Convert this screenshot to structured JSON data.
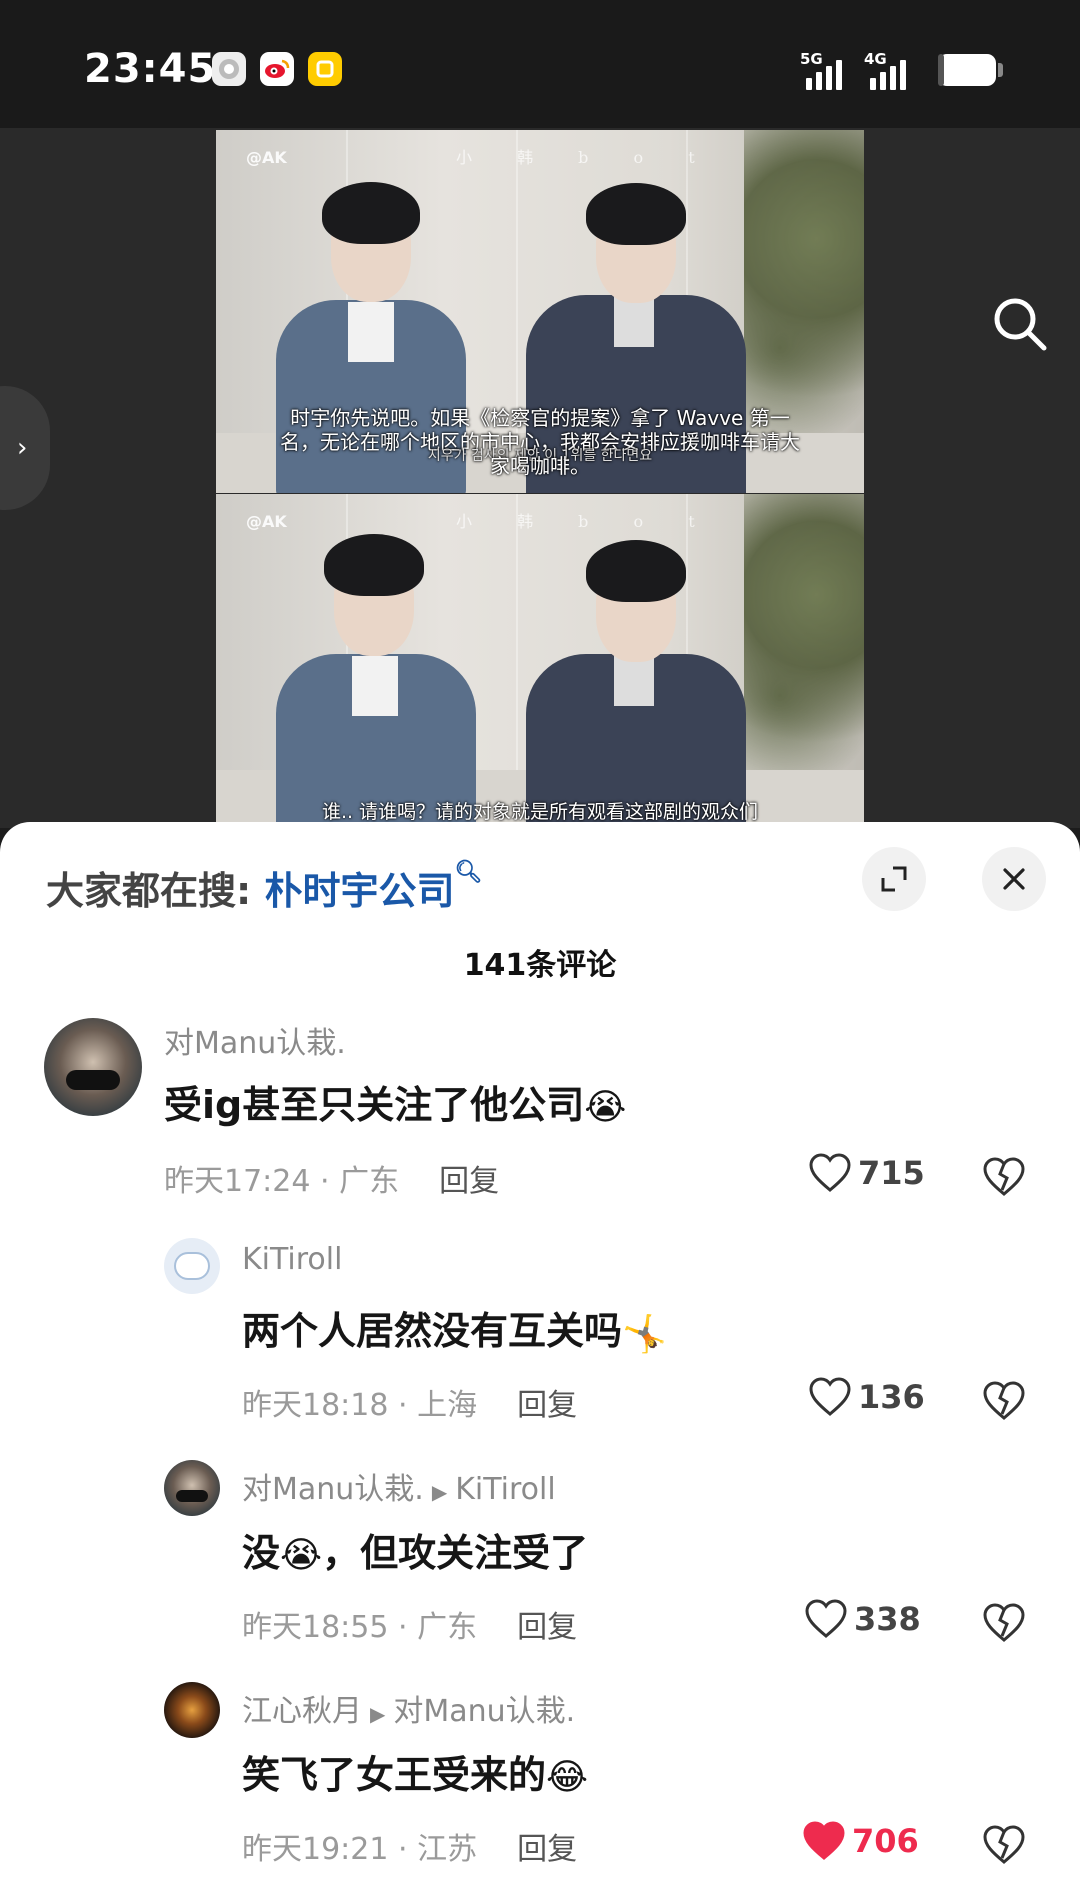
{
  "status_bar": {
    "time": "23:45",
    "network_1": "5G",
    "network_2": "4G",
    "battery": "5",
    "battery_level": 0.05
  },
  "video": {
    "watermark": "@AK",
    "watermark_channel": "小  韩  b  o  t",
    "subtitle_1_line1": "时宇你先说吧。如果《检察官的提案》拿了 Wavve 第一",
    "subtitle_1_line2": "名，无论在哪个地区的市中心，我都会安排应援咖啡车请大",
    "subtitle_1_line3": "家喝咖啡。",
    "subtitle_1_korean": "시우가 검사의 제안 이 1위를 한다면요",
    "subtitle_2": "谁.. 请谁喝？请的对象就是所有观看这部剧的观众们"
  },
  "panel": {
    "hot_search_prefix": "大家都在搜: ",
    "hot_search_keyword": "朴时宇公司",
    "comment_count": "141条评论"
  },
  "comments": [
    {
      "name": "对Manu认栽.",
      "text": "受ig甚至只关注了他公司",
      "emoji": "😭",
      "time": "昨天17:24",
      "location": "广东",
      "reply": "回复",
      "likes": "715",
      "liked": false
    },
    {
      "name": "KiTiroll",
      "text": "两个人居然没有互关吗",
      "emoji": "🤸",
      "time": "昨天18:18",
      "location": "上海",
      "reply": "回复",
      "likes": "136",
      "liked": false
    },
    {
      "name": "对Manu认栽.",
      "reply_to": "KiTiroll",
      "text_before": "没",
      "emoji": "😭",
      "text_after": "，但攻关注受了",
      "time": "昨天18:55",
      "location": "广东",
      "reply": "回复",
      "likes": "338",
      "liked": false
    },
    {
      "name": "江心秋月",
      "reply_to": "对Manu认栽.",
      "text": "笑飞了女王受来的",
      "emoji": "😂",
      "time": "昨天19:21",
      "location": "江苏",
      "reply": "回复",
      "likes": "706",
      "liked": true
    }
  ],
  "colors": {
    "accent_link": "#1a58a8",
    "liked_red": "#ee2b4e",
    "meta_gray": "#9a9a9a"
  }
}
